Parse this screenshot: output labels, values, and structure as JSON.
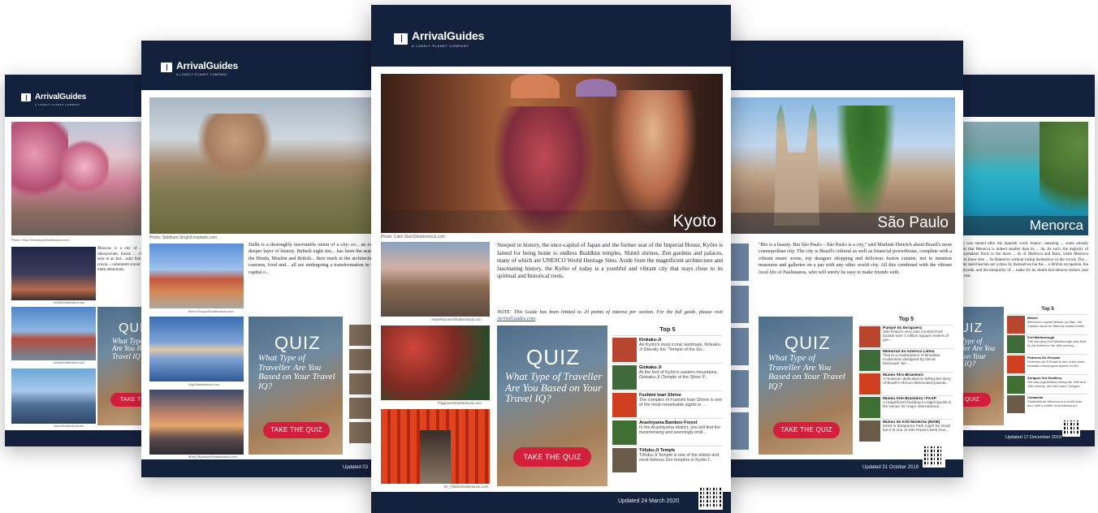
{
  "brand": {
    "name": "ArrivalGuides",
    "tagline": "A LONELY PLANET COMPANY"
  },
  "common": {
    "quiz_title": "QUIZ",
    "quiz_sub": "What Type of Traveller Are You Based on Your Travel IQ?",
    "quiz_button": "TAKE THE QUIZ",
    "top5_title": "Top 5"
  },
  "guides": {
    "moscow": {
      "hero_credit": "Photo: Yulia Tereshina/Shutterstock.com",
      "text": "Moscow is a city of ... an idiosyncratic fusion ... church next to an Ital... salty fish eggs (cavia... commuters travel by ... mum attractions.",
      "credits": [
        "ahmlia/Shutterstock.com",
        "ahmlia/Shutterstock.com",
        "Jayns/Shutterstock.com"
      ]
    },
    "delhi": {
      "hero_credit": "Photo: Siddhant Singh/Unsplash.com",
      "text": "Delhi is a thoroughly inscrutable onion of a city; ev... an even deeper layer of history. Rebuilt eight tim... has been the seat of the Hindu, Muslim and British... their mark in the architecture, customs, food and... all are undergoing a transformation in the capital o...",
      "credits": [
        "Berra Strogio/Shutterstock.com",
        "Wg/Shutterstock.com",
        "Mukul Banerjee/Shutterstock.com"
      ],
      "updated": "Updated 03"
    },
    "kyoto": {
      "city": "Kyoto",
      "hero_credit": "Photo: Calin Stan/Shutterstock.com",
      "text": "Steeped in history, the once-capital of Japan and the former seat of the Imperial House, Kyōto is famed for being home to endless Buddhist temples, Shintō shrines, Zen gardens and palaces, many of which are UNESCO World Heritage Sites. Aside from the magnificent architecture and fascinating history, the Kyōto of today is a youthful and vibrant city that stays close to its spiritual and historical roots.",
      "note": "NOTE: This Guide has been limited to 20 points of interest per section. For the full guide, please visit ",
      "note_link": "ArrivalGuides.com",
      "credits": [
        "SeanPavone/Shutterstock.com",
        "Pajgreen/Shutterstock.com",
        "Dr_Flash/Shutterstock.com"
      ],
      "top5": [
        {
          "name": "Kinkaku-Ji",
          "desc": "As Kyōto's most iconic landmark, Kinkaku-Ji (literally the \"Temple of the Go..."
        },
        {
          "name": "Ginkaku-Ji",
          "desc": "At the foot of Kyōto's eastern mountains, Ginkaku-Ji (Temple of the Silver P..."
        },
        {
          "name": "Fushimi Inari Shrine",
          "desc": "The complex of Fushimi Inari Shrine is one of the most remarkable sights in ..."
        },
        {
          "name": "Arashiyama Bamboo Forest",
          "desc": "In the Arashiyama district, you will find the mesmerising and seemingly endl..."
        },
        {
          "name": "Tōfuku-Ji Temple",
          "desc": "Tōfuku-Ji Temple is one of the oldest and most famous Zen temples in Kyōto f..."
        }
      ],
      "updated": "Updated 24 March 2020"
    },
    "saopaulo": {
      "city": "São Paulo",
      "text": "\"Rio is a beauty. But São Paulo – São Paulo is a city,\" said Marlene Dietrich about Brazil's most cosmopolitan city. The city is Brazil's cultural as well as financial powerhouse, complete with a vibrant music scene, top designer shopping and delicious fusion cuisine, not to mention museums and galleries on a par with any other world city. All this combined with the vibrant local life of Paulistanos, who will surely be easy to make friends with.",
      "top5": [
        {
          "name": "Parque do Ibirapuera",
          "desc": "São Paulo's very own Central Park boasts over 2 million square meters of gre..."
        },
        {
          "name": "Memorial da America Latina",
          "desc": "This is a masterpiece of Brazilian modernism designed by Oscar Niemeyer. Be ..."
        },
        {
          "name": "Museu Afro-Brasileiro",
          "desc": "A museum dedicated to telling the story of Brazil's African-descended popula..."
        },
        {
          "name": "Museu Arte Brasileira / FAAP",
          "desc": "A magnificent building in Higienópolis is the venue for major international ..."
        },
        {
          "name": "Museu de Arte Moderna (MAM)",
          "desc": "MAM in Ibirapuera Park might be small, but it is one of São Paulo's best mus..."
        }
      ],
      "updated": "Updated 31 October 2019"
    },
    "menorca": {
      "city": "Menorca",
      "text": "...rca) was named after the Spanish word 'menor', meaning ... some already reveals that Menorca is indeed smaller than its ... da. As such, the majority of holidaymakers flock to the more ... ds of Mallorca and Ibiza, while Menorca attracts those who ... he Balearics without losing themselves in the crowd. The ... e white sand beaches are a draw by themselves but the ... e British occupation, the countryside, and the tranquility of ... make for its charm that attracts visitors year after year.",
      "top5": [
        {
          "name": "Mahón",
          "desc": "Menorca's capital Mahón (or Maó, the Catalan name for Mahón) boasts terrific..."
        },
        {
          "name": "Fort Marlborough",
          "desc": "The low-lying Fort Marlborough was built by the British in the 18th century,..."
        },
        {
          "name": "Pedreres De S'hostal",
          "desc": "Pedreres de S'Hostal is one of the most beautiful ethnological places on the..."
        },
        {
          "name": "Xoriguer Gin Distillery",
          "desc": "Gin was popularised during the 18th and 19th century, and the brand 'Xorigue..."
        },
        {
          "name": "Ciutadella",
          "desc": "Ciutadella de Menorca is a small town and, with a surfeit of architectural f..."
        }
      ],
      "updated": "Updated 17 December 2019"
    }
  },
  "colors": {
    "navy": "#14213d",
    "quiz_red": "#d21f3c"
  },
  "icons": [
    "book-logo-icon",
    "qr-code-icon"
  ]
}
